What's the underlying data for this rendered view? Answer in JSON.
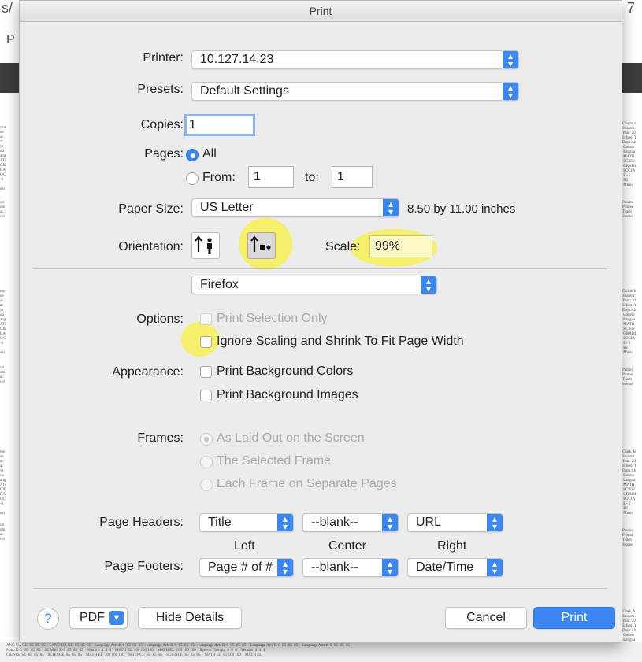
{
  "window": {
    "title": "Print"
  },
  "background": {
    "top_left_glyph": "s/",
    "top_right_glyph": "7",
    "side_glyph": "P",
    "right_column": [
      "Chapma\nStudent I\nYear: 20\nSchool Y\nDays Ab\n Course\n Langua\n MATH\n SCIEN\n GRADE\n SOCIA\n K- 6\n PE\n Music",
      "Passin\nPromo\nTeach\nSteens",
      "Cichielli\nStudent I\nYear: 20\nSchool Y\nDays Ab\n Course\n Langua\n MATH\n SCIEN\n GRADE\n SOCIA\n K- 6\n PE\n Music",
      "Passin\nPromo\nTeach\nSteens",
      "Clark, B\nStudent I\nYear: 20\nSchool Y\nDays Ab\n Course\n Langua\n MATH\n SCIEN\n GRADE\n SOCIA\n K- 6\n PE\n Music",
      "Passin\nPromo\nTeach\nSteens",
      "Clark, S\nStudent I\nYear: 20\nSchool Y\nDays Ab\n Course\n Langua\n Venture\n MATH"
    ],
    "left_column": [
      "sme\nde\nar:\nal\nys\nou\nang\nATI\nCIE\nRA\nOC\n-6\n\nusi",
      "ssi\nom\nac\ncer",
      "me\nde\nar:\nal\nys\nou\nang\nATI\nCIE\nRA\nOC\n-6\n\nusi",
      "ssi\nom\nac\ncer",
      "me\nde\nar:\nal\nys\nou\nang\nATI\nCIE\nRA\nOC\n-6\n\nusi",
      "ssi\nom\nac\ncer"
    ],
    "bottom_strip": "ANG UA GE  85  85  85    LANG UA GE  85  85  85    Language Arts K-6  85  85  85    Language Arts K-6  85  85  85    Language Arts K-6  85  85  85    Language Arts K-6  85  85  85    Language Arts K-6  85  85  85\nMath K-6   85  85  85    SE Math K-6  85  85  85    Venture  4  4  4    MATH EL  100 100 100    MATH EL  100 100 100    Speech Therapy  0  0  0    Venture  4  4  4\nCIENCE SE  85  85  85    SCIENCE  85  85  85    MATH EL  100 100 100    SCIENCE  85  85  85    SCIENCE  85  85  85    MATH EL  85 100 100    MATH EL"
  },
  "printer": {
    "label": "Printer:",
    "value": "10.127.14.23"
  },
  "presets": {
    "label": "Presets:",
    "value": "Default Settings"
  },
  "copies": {
    "label": "Copies:",
    "value": "1"
  },
  "pages": {
    "label": "Pages:",
    "all": "All",
    "from_label": "From:",
    "from_value": "1",
    "to_label": "to:",
    "to_value": "1"
  },
  "paper_size": {
    "label": "Paper Size:",
    "value": "US Letter",
    "dimensions": "8.50 by 11.00 inches"
  },
  "orientation": {
    "label": "Orientation:",
    "selected": "landscape"
  },
  "scale": {
    "label": "Scale:",
    "value": "99%"
  },
  "section_menu": {
    "value": "Firefox"
  },
  "options": {
    "label": "Options:",
    "print_selection_only": {
      "label": "Print Selection Only",
      "enabled": false,
      "checked": false
    },
    "ignore_scaling": {
      "label": "Ignore Scaling and Shrink To Fit Page Width",
      "enabled": true,
      "checked": false
    }
  },
  "appearance": {
    "label": "Appearance:",
    "background_colors": {
      "label": "Print Background Colors",
      "checked": false
    },
    "background_images": {
      "label": "Print Background Images",
      "checked": false
    }
  },
  "frames": {
    "label": "Frames:",
    "options": [
      "As Laid Out on the Screen",
      "The Selected Frame",
      "Each Frame on Separate Pages"
    ],
    "selected_index": 0,
    "enabled": false
  },
  "headers": {
    "label": "Page Headers:",
    "left": "Title",
    "center": "--blank--",
    "right": "URL"
  },
  "column_labels": {
    "left": "Left",
    "center": "Center",
    "right": "Right"
  },
  "footers": {
    "label": "Page Footers:",
    "left": "Page # of #",
    "center": "--blank--",
    "right": "Date/Time"
  },
  "buttons": {
    "help": "?",
    "pdf": "PDF",
    "hide_details": "Hide Details",
    "cancel": "Cancel",
    "print": "Print"
  },
  "colors": {
    "accent": "#3b86f0",
    "sheet": "#ececec",
    "highlight": "#fff200"
  }
}
